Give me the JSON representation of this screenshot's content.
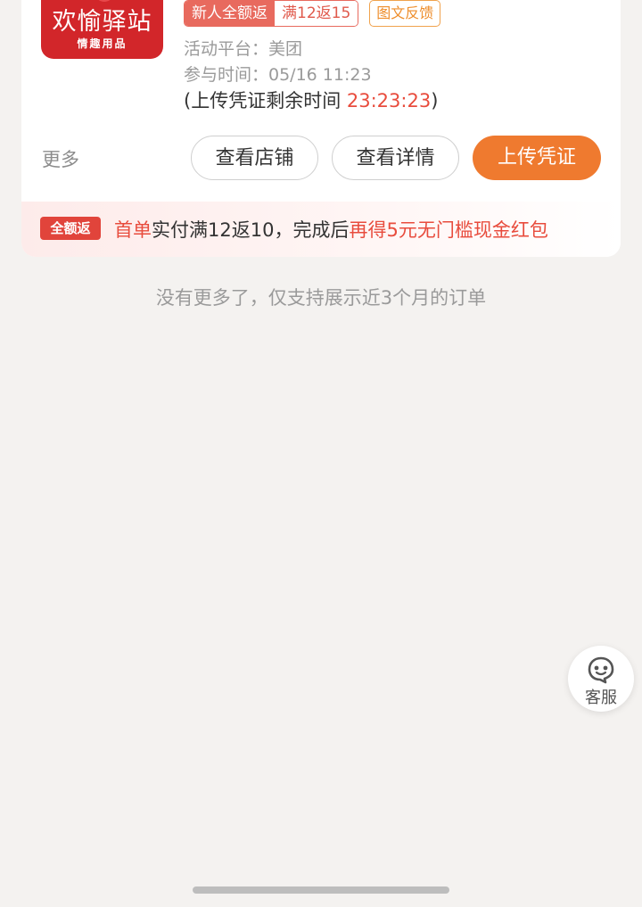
{
  "order": {
    "shop_logo": {
      "name": "欢愉驿站",
      "subtitle": "情趣用品"
    },
    "badges": {
      "type": "新人全额返",
      "rule": "满12返15",
      "feedback": "图文反馈"
    },
    "platform": "活动平台：美团",
    "join_time": "参与时间：05/16 11:23",
    "deadline": {
      "prefix": "(上传凭证剩余时间 ",
      "time": "23:23:23",
      "suffix": ")"
    },
    "more_label": "更多",
    "buttons": {
      "view_shop": "查看店铺",
      "view_detail": "查看详情",
      "upload": "上传凭证"
    },
    "promo": {
      "tag": "全额返",
      "first": "首单",
      "middle": "实付满12返10，完成后",
      "bonus": "再得5元无门槛现金红包"
    }
  },
  "footer_text": "没有更多了，仅支持展示近3个月的订单",
  "service": {
    "label": "客服",
    "icon": "customer-service-icon"
  },
  "colors": {
    "accent": "#ef7a2f",
    "red": "#e84c3d",
    "logo_bg": "#d2262a"
  }
}
